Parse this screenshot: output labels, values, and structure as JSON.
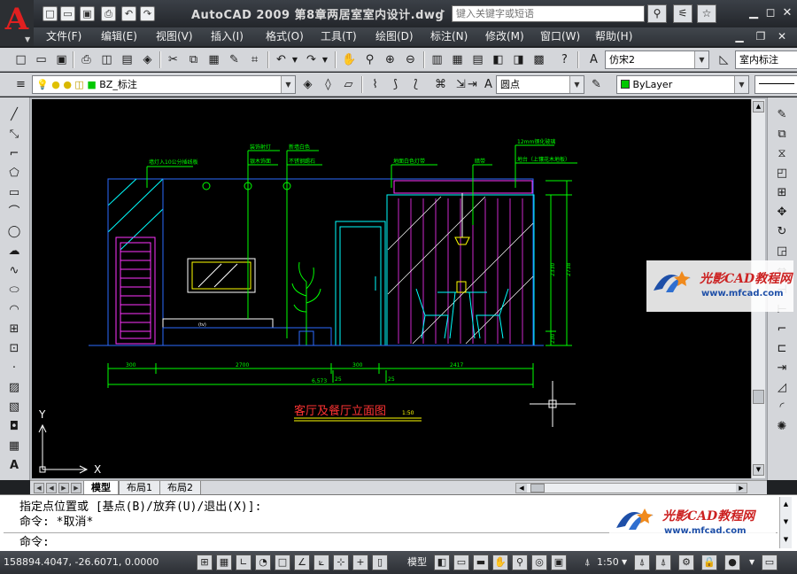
{
  "window": {
    "title": "AutoCAD 2009  第8章两居室室内设计.dwg",
    "search_placeholder": "键入关键字或短语"
  },
  "menu": {
    "items": [
      "文件(F)",
      "编辑(E)",
      "视图(V)",
      "插入(I)",
      "格式(O)",
      "工具(T)",
      "绘图(D)",
      "标注(N)",
      "修改(M)",
      "窗口(W)",
      "帮助(H)"
    ]
  },
  "toolbar_styles": {
    "text_style": "仿宋2",
    "dim_style": "室内标注"
  },
  "toolbar_layers": {
    "layer": "BZ_标注",
    "point_style": "圆点",
    "color": "ByLayer",
    "color_swatch": "#00c800"
  },
  "drawing": {
    "title": "客厅及餐厅立面图",
    "scale": "1:50",
    "annotations": {
      "a1": "墙灯入10公分插线板",
      "a2": "装饰射灯",
      "a3": "银木饰面",
      "a4": "新墙白色",
      "a5": "不锈钢踢石",
      "a6": "地面白色灯带",
      "a7": "暗带",
      "a8": "12mm钢化玻璃",
      "a9": "地台（上镶花木地板）",
      "tv_text": "(tv)"
    },
    "dimensions": {
      "d1": "300",
      "d2": "2700",
      "d3": "300",
      "d4": "2417",
      "d5": "6,573",
      "d6": "25",
      "d7": "25",
      "d8": "2330",
      "d9": "2738",
      "d10": "230"
    },
    "axis": {
      "x": "X",
      "y": "Y"
    },
    "colors": {
      "background": "#000000",
      "line_blue": "#2d6bff",
      "line_green": "#00ff00",
      "line_cyan": "#00ffff",
      "line_magenta": "#ff33ff",
      "line_yellow": "#ffff00",
      "line_white": "#ffffff"
    }
  },
  "layout_tabs": {
    "model": "模型",
    "layout1": "布局1",
    "layout2": "布局2"
  },
  "command": {
    "line1": "指定点位置或 [基点(B)/放弃(U)/退出(X)]:",
    "line2": "命令: *取消*",
    "prompt": "命令:"
  },
  "status": {
    "coords": "158894.4047, -26.6071, 0.0000",
    "model_label": "模型",
    "annotation_scale": "1:50"
  },
  "watermark": {
    "title": "光影CAD教程网",
    "url": "www.mfcad.com"
  },
  "icons": [
    "autocad-logo-icon",
    "new-icon",
    "open-icon",
    "save-icon",
    "print-icon",
    "undo-icon",
    "redo-icon",
    "search-icon",
    "star-icon",
    "minimize-icon",
    "maximize-icon",
    "close-icon"
  ]
}
